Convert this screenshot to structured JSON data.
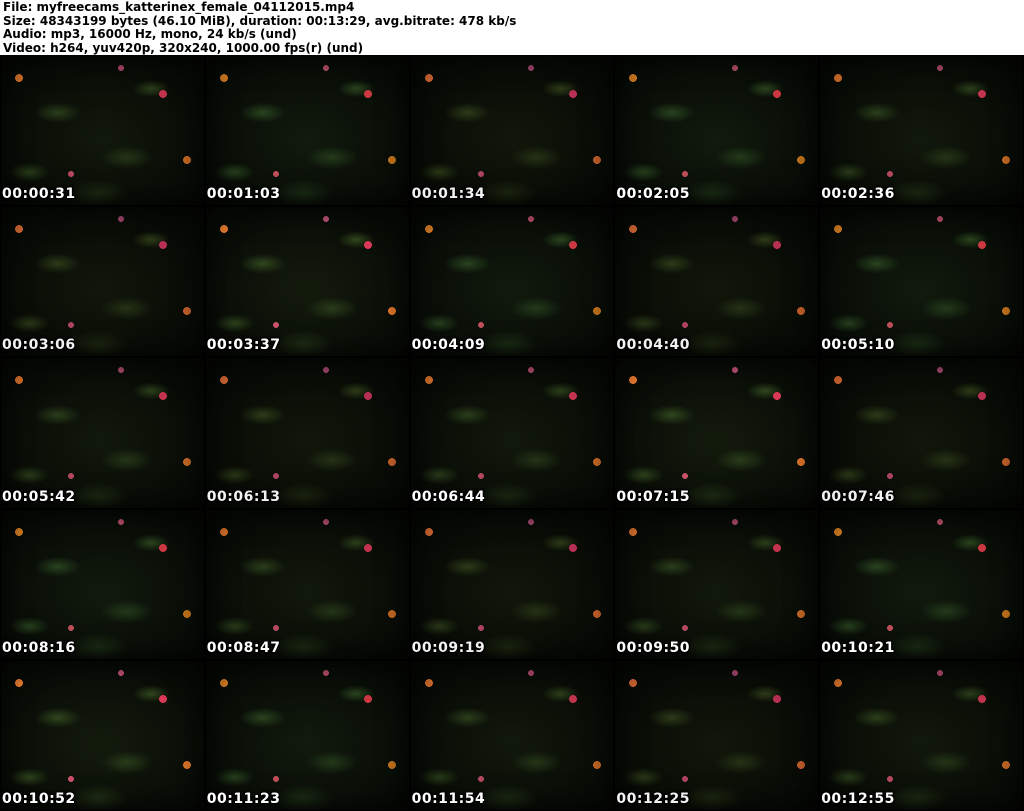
{
  "header": {
    "file_line": "File: myfreecams_katterinex_female_04112015.mp4",
    "size_line": "Size: 48343199 bytes (46.10 MiB), duration: 00:13:29, avg.bitrate: 478 kb/s",
    "audio_line": "Audio: mp3, 16000 Hz, mono, 24 kb/s (und)",
    "video_line": "Video: h264, yuv420p, 320x240, 1000.00 fps(r) (und)"
  },
  "grid": {
    "timestamps": [
      "00:00:31",
      "00:01:03",
      "00:01:34",
      "00:02:05",
      "00:02:36",
      "00:03:06",
      "00:03:37",
      "00:04:09",
      "00:04:40",
      "00:05:10",
      "00:05:42",
      "00:06:13",
      "00:06:44",
      "00:07:15",
      "00:07:46",
      "00:08:16",
      "00:08:47",
      "00:09:19",
      "00:09:50",
      "00:10:21",
      "00:10:52",
      "00:11:23",
      "00:11:54",
      "00:12:25",
      "00:12:55"
    ]
  },
  "colors": {
    "header_background": "#ffffff",
    "header_text": "#000000",
    "timestamp_text": "#ffffff",
    "timestamp_outline": "#000000",
    "tile_background": "#0d1208"
  }
}
